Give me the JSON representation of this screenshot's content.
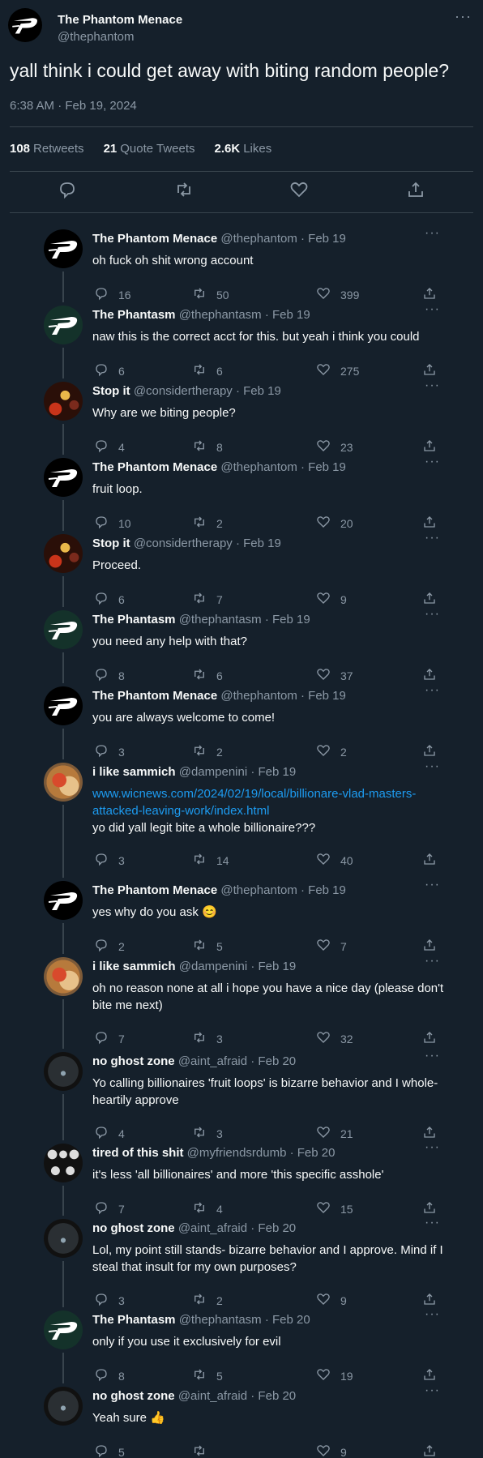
{
  "main": {
    "name": "The Phantom Menace",
    "handle": "@thephantom",
    "text": "yall think i could get away with biting random people?",
    "timestamp": "6:38 AM · Feb 19, 2024",
    "stats": {
      "retweets_count": "108",
      "retweets_label": "Retweets",
      "quotes_count": "21",
      "quotes_label": "Quote Tweets",
      "likes_count": "2.6K",
      "likes_label": "Likes"
    },
    "more": "···"
  },
  "replies": [
    {
      "name": "The Phantom Menace",
      "meta": "@thephantom · Feb 19",
      "text": "oh fuck oh shit wrong account",
      "replies": "16",
      "retweets": "50",
      "likes": "399",
      "avatar": "phantom-logo"
    },
    {
      "name": "The Phantasm",
      "meta": "@thephantasm · Feb 19",
      "text": "naw this is the correct acct for this. but yeah i think you could",
      "replies": "6",
      "retweets": "6",
      "likes": "275",
      "avatar": "phantom-logo-green"
    },
    {
      "name": "Stop it",
      "meta": "@considertherapy · Feb 19",
      "text": "Why are we biting people?",
      "replies": "4",
      "retweets": "8",
      "likes": "23",
      "avatar": "bottles-photo"
    },
    {
      "name": "The Phantom Menace",
      "meta": "@thephantom · Feb 19",
      "text": "fruit loop.",
      "replies": "10",
      "retweets": "2",
      "likes": "20",
      "avatar": "phantom-logo"
    },
    {
      "name": "Stop it",
      "meta": "@considertherapy · Feb 19",
      "text": "Proceed.",
      "replies": "6",
      "retweets": "7",
      "likes": "9",
      "avatar": "bottles-photo"
    },
    {
      "name": "The Phantasm",
      "meta": "@thephantasm · Feb 19",
      "text": "you need any help with that?",
      "replies": "8",
      "retweets": "6",
      "likes": "37",
      "avatar": "phantom-logo-green"
    },
    {
      "name": "The Phantom Menace",
      "meta": "@thephantom · Feb 19",
      "text": "you are always welcome to come!",
      "replies": "3",
      "retweets": "2",
      "likes": "2",
      "avatar": "phantom-logo"
    },
    {
      "name": "i like sammich",
      "meta": "@dampenini · Feb 19",
      "link_line1": "www.wicnews.com/2024/02/19/local/billionare-vlad-masters-",
      "link_line2": "attacked-leaving-work/index.html",
      "text": "yo did yall legit bite a whole billionaire???",
      "replies": "3",
      "retweets": "14",
      "likes": "40",
      "avatar": "sandwich-photo"
    },
    {
      "name": "The Phantom Menace",
      "meta": "@thephantom · Feb 19",
      "text": "yes why do you ask 😊",
      "replies": "2",
      "retweets": "5",
      "likes": "7",
      "avatar": "phantom-logo"
    },
    {
      "name": "i like sammich",
      "meta": "@dampenini · Feb 19",
      "text": "oh no reason none at all i hope you have a nice day (please don't bite me next)",
      "replies": "7",
      "retweets": "3",
      "likes": "32",
      "avatar": "sandwich-photo"
    },
    {
      "name": "no ghost zone",
      "meta": "@aint_afraid · Feb 20",
      "text": "Yo calling billionaires 'fruit loops' is bizarre behavior and I whole-heartily approve",
      "replies": "4",
      "retweets": "3",
      "likes": "21",
      "avatar": "ghost-photo"
    },
    {
      "name": "tired of this shit",
      "meta": "@myfriendsrdumb · Feb 20",
      "text": "it's less 'all billionaires' and more 'this specific asshole'",
      "replies": "7",
      "retweets": "4",
      "likes": "15",
      "avatar": "skulls-photo"
    },
    {
      "name": "no ghost zone",
      "meta": "@aint_afraid · Feb 20",
      "text": "Lol, my point still stands- bizarre behavior and I approve. Mind if I steal that insult for my own purposes?",
      "replies": "3",
      "retweets": "2",
      "likes": "9",
      "avatar": "ghost-photo"
    },
    {
      "name": "The Phantasm",
      "meta": "@thephantasm · Feb 20",
      "text": "only if you use it exclusively for evil",
      "replies": "8",
      "retweets": "5",
      "likes": "19",
      "avatar": "phantom-logo-green"
    },
    {
      "name": "no ghost zone",
      "meta": "@aint_afraid · Feb 20",
      "text": "Yeah sure 👍",
      "replies": "5",
      "retweets": "",
      "likes": "9",
      "avatar": "ghost-photo"
    }
  ],
  "more_label": "···"
}
